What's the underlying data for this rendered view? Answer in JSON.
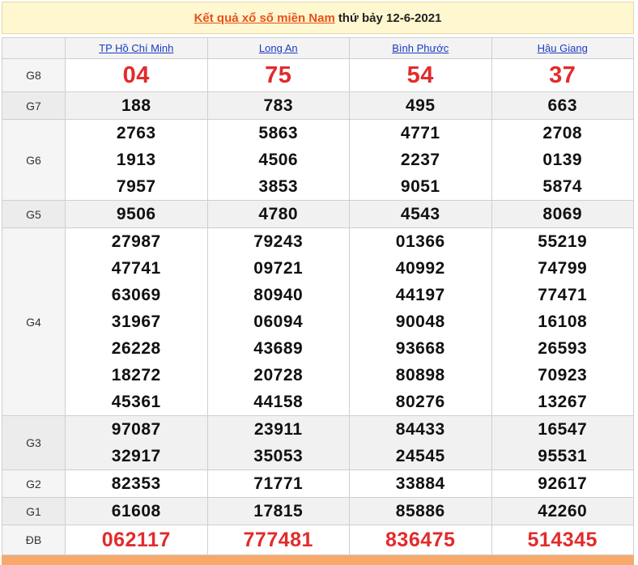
{
  "header": {
    "title_link": "Kết quả xổ số miền Nam",
    "title_rest": "thứ bảy 12-6-2021"
  },
  "provinces": [
    "TP Hồ Chí Minh",
    "Long An",
    "Bình Phước",
    "Hậu Giang"
  ],
  "prizes": [
    {
      "label": "G8",
      "type": "g8",
      "alt": false,
      "values": [
        [
          "04"
        ],
        [
          "75"
        ],
        [
          "54"
        ],
        [
          "37"
        ]
      ]
    },
    {
      "label": "G7",
      "type": "normal",
      "alt": true,
      "values": [
        [
          "188"
        ],
        [
          "783"
        ],
        [
          "495"
        ],
        [
          "663"
        ]
      ]
    },
    {
      "label": "G6",
      "type": "normal",
      "alt": false,
      "values": [
        [
          "2763",
          "1913",
          "7957"
        ],
        [
          "5863",
          "4506",
          "3853"
        ],
        [
          "4771",
          "2237",
          "9051"
        ],
        [
          "2708",
          "0139",
          "5874"
        ]
      ]
    },
    {
      "label": "G5",
      "type": "normal",
      "alt": true,
      "values": [
        [
          "9506"
        ],
        [
          "4780"
        ],
        [
          "4543"
        ],
        [
          "8069"
        ]
      ]
    },
    {
      "label": "G4",
      "type": "normal",
      "alt": false,
      "values": [
        [
          "27987",
          "47741",
          "63069",
          "31967",
          "26228",
          "18272",
          "45361"
        ],
        [
          "79243",
          "09721",
          "80940",
          "06094",
          "43689",
          "20728",
          "44158"
        ],
        [
          "01366",
          "40992",
          "44197",
          "90048",
          "93668",
          "80898",
          "80276"
        ],
        [
          "55219",
          "74799",
          "77471",
          "16108",
          "26593",
          "70923",
          "13267"
        ]
      ]
    },
    {
      "label": "G3",
      "type": "normal",
      "alt": true,
      "values": [
        [
          "97087",
          "32917"
        ],
        [
          "23911",
          "35053"
        ],
        [
          "84433",
          "24545"
        ],
        [
          "16547",
          "95531"
        ]
      ]
    },
    {
      "label": "G2",
      "type": "normal",
      "alt": false,
      "values": [
        [
          "82353"
        ],
        [
          "71771"
        ],
        [
          "33884"
        ],
        [
          "92617"
        ]
      ]
    },
    {
      "label": "G1",
      "type": "normal",
      "alt": true,
      "values": [
        [
          "61608"
        ],
        [
          "17815"
        ],
        [
          "85886"
        ],
        [
          "42260"
        ]
      ]
    },
    {
      "label": "ĐB",
      "type": "db",
      "alt": false,
      "values": [
        [
          "062117"
        ],
        [
          "777481"
        ],
        [
          "836475"
        ],
        [
          "514345"
        ]
      ]
    }
  ]
}
